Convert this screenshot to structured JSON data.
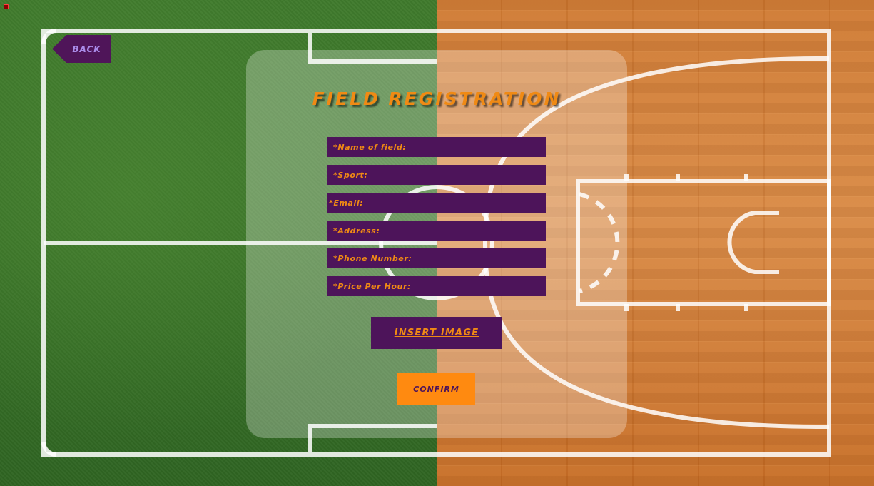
{
  "navigation": {
    "back_label": "BACK"
  },
  "form": {
    "title": "FIELD REGISTRATION",
    "fields": {
      "name": {
        "placeholder": "*Name of field:",
        "value": ""
      },
      "sport": {
        "placeholder": "*Sport:",
        "value": ""
      },
      "email": {
        "placeholder": "*Email:",
        "value": ""
      },
      "address": {
        "placeholder": "*Address:",
        "value": ""
      },
      "phone": {
        "placeholder": "*Phone Number:",
        "value": ""
      },
      "price": {
        "placeholder": "*Price Per Hour:",
        "value": ""
      }
    },
    "insert_image_label": "INSERT IMAGE",
    "confirm_label": "CONFIRM"
  },
  "colors": {
    "accent": "#f08a14",
    "field_bg": "#4d145a",
    "back_text": "#a98be8",
    "confirm_bg": "#ff8a10",
    "grass": "#3a7428",
    "wood": "#d08035"
  }
}
